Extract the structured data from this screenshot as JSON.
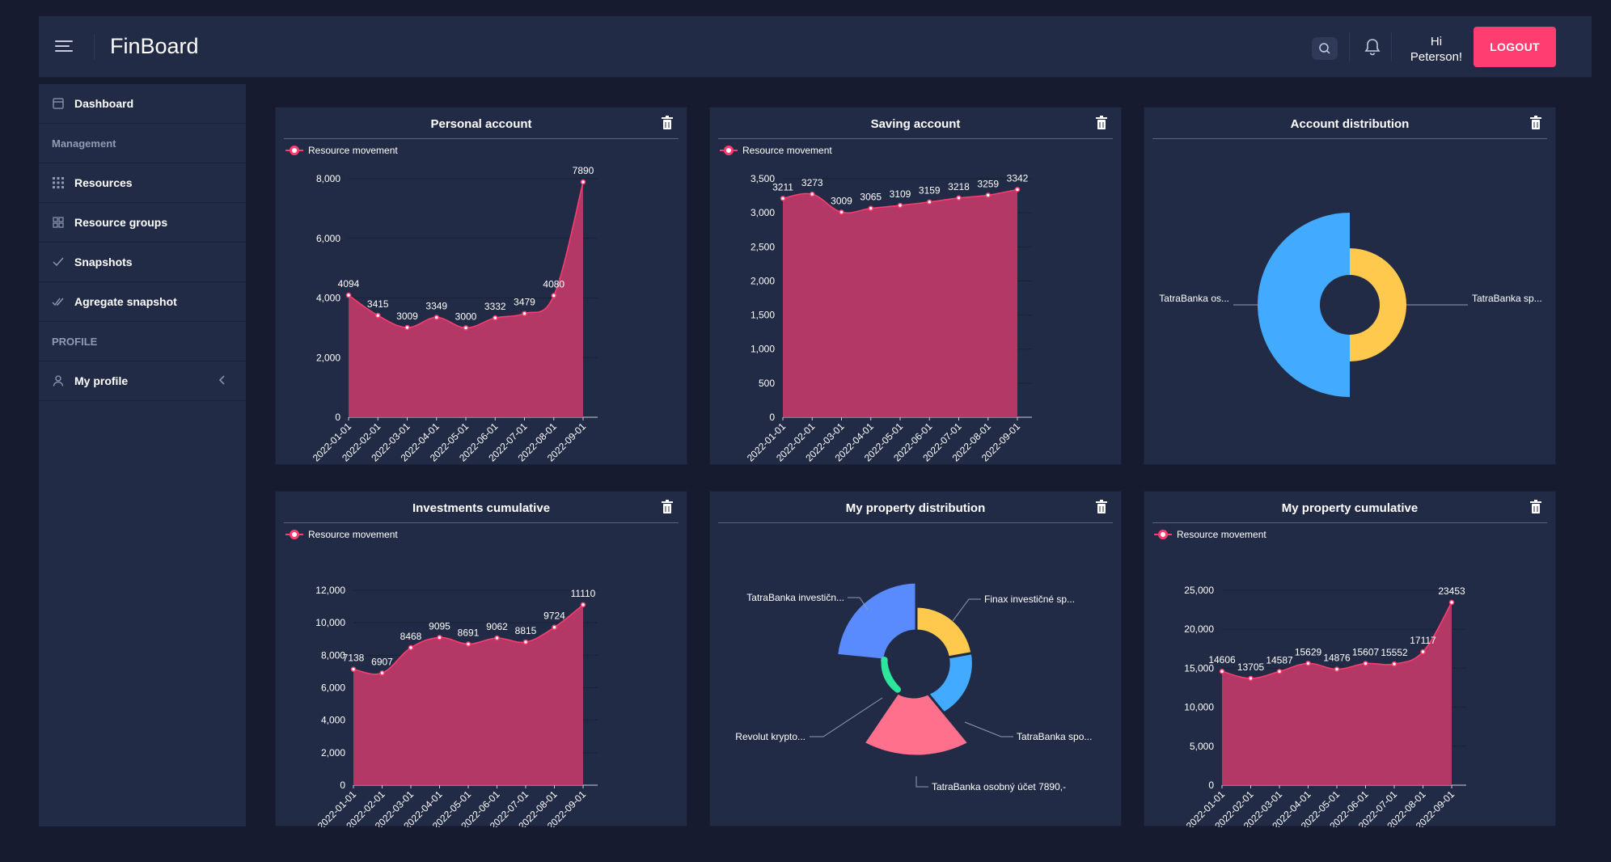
{
  "header": {
    "brand": "FinBoard",
    "greeting": "Hi Peterson!",
    "logout": "LOGOUT"
  },
  "sidebar": {
    "items": [
      {
        "label": "Dashboard"
      },
      {
        "label": "Management"
      },
      {
        "label": "Resources"
      },
      {
        "label": "Resource groups"
      },
      {
        "label": "Snapshots"
      },
      {
        "label": "Agregate snapshot"
      },
      {
        "label": "PROFILE"
      },
      {
        "label": "My profile"
      }
    ]
  },
  "colors": {
    "accent": "#ff3d71",
    "area": "#c13a68",
    "blue": "#42aaff",
    "yellow": "#ffc94d",
    "green": "#2ce69b",
    "indigo": "#598bff",
    "pink": "#ff708d"
  },
  "cards": {
    "personal": {
      "title": "Personal account",
      "legend": "Resource movement"
    },
    "saving": {
      "title": "Saving account",
      "legend": "Resource movement"
    },
    "distribution": {
      "title": "Account distribution"
    },
    "investments": {
      "title": "Investments cumulative",
      "legend": "Resource movement"
    },
    "property_dist": {
      "title": "My property distribution"
    },
    "property_cum": {
      "title": "My property cumulative",
      "legend": "Resource movement"
    }
  },
  "chart_data": [
    {
      "type": "area",
      "title": "Personal account",
      "series": [
        {
          "name": "Resource movement",
          "values": [
            4094,
            3415,
            3009,
            3349,
            3000,
            3332,
            3479,
            4080,
            7890
          ]
        }
      ],
      "x": [
        "2022-01-01",
        "2022-02-01",
        "2022-03-01",
        "2022-04-01",
        "2022-05-01",
        "2022-06-01",
        "2022-07-01",
        "2022-08-01",
        "2022-09-01"
      ],
      "ylim": [
        0,
        8000
      ],
      "yticks": [
        0,
        2000,
        4000,
        6000,
        8000
      ],
      "ytick_labels": [
        "0",
        "2,000",
        "4,000",
        "6,000",
        "8,000"
      ],
      "labels": [
        "4094",
        "3415",
        "3009",
        "3349",
        "3000",
        "3332",
        "3479",
        "4080",
        "7890"
      ]
    },
    {
      "type": "area",
      "title": "Saving account",
      "series": [
        {
          "name": "Resource movement",
          "values": [
            3211,
            3273,
            3009,
            3065,
            3109,
            3159,
            3218,
            3259,
            3342
          ]
        }
      ],
      "x": [
        "2022-01-01",
        "2022-02-01",
        "2022-03-01",
        "2022-04-01",
        "2022-05-01",
        "2022-06-01",
        "2022-07-01",
        "2022-08-01",
        "2022-09-01"
      ],
      "ylim": [
        0,
        3500
      ],
      "yticks": [
        0,
        500,
        1000,
        1500,
        2000,
        2500,
        3000,
        3500
      ],
      "ytick_labels": [
        "0",
        "500",
        "1,000",
        "1,500",
        "2,000",
        "2,500",
        "3,000",
        "3,500"
      ],
      "labels": [
        "3211",
        "3273",
        "3009",
        "3065",
        "3109",
        "3159",
        "3218",
        "3259",
        "3342"
      ]
    },
    {
      "type": "pie",
      "title": "Account distribution",
      "categories": [
        "TatraBanka os...",
        "TatraBanka sp..."
      ],
      "values": [
        7890,
        3342
      ]
    },
    {
      "type": "area",
      "title": "Investments cumulative",
      "series": [
        {
          "name": "Resource movement",
          "values": [
            7138,
            6907,
            8468,
            9095,
            8691,
            9062,
            8815,
            9724,
            11110
          ]
        }
      ],
      "x": [
        "2022-01-01",
        "2022-02-01",
        "2022-03-01",
        "2022-04-01",
        "2022-05-01",
        "2022-06-01",
        "2022-07-01",
        "2022-08-01",
        "2022-09-01"
      ],
      "ylim": [
        0,
        12000
      ],
      "yticks": [
        0,
        2000,
        4000,
        6000,
        8000,
        10000,
        12000
      ],
      "ytick_labels": [
        "0",
        "2,000",
        "4,000",
        "6,000",
        "8,000",
        "10,000",
        "12,000"
      ],
      "labels": [
        "7138",
        "6907",
        "8468",
        "9095",
        "8691",
        "9062",
        "8815",
        "9724",
        "11110"
      ]
    },
    {
      "type": "pie",
      "title": "My property distribution",
      "categories": [
        "TatraBanka investičn...",
        "Finax investičné sp...",
        "TatraBanka spo...",
        "TatraBanka osobný účet 7890,-",
        "Revolut krypto..."
      ]
    },
    {
      "type": "area",
      "title": "My property cumulative",
      "series": [
        {
          "name": "Resource movement",
          "values": [
            14606,
            13705,
            14587,
            15629,
            14876,
            15607,
            15552,
            17117,
            23453
          ]
        }
      ],
      "x": [
        "2022-01-01",
        "2022-02-01",
        "2022-03-01",
        "2022-04-01",
        "2022-05-01",
        "2022-06-01",
        "2022-07-01",
        "2022-08-01",
        "2022-09-01"
      ],
      "ylim": [
        0,
        25000
      ],
      "yticks": [
        0,
        5000,
        10000,
        15000,
        20000,
        25000
      ],
      "ytick_labels": [
        "0",
        "5,000",
        "10,000",
        "15,000",
        "20,000",
        "25,000"
      ],
      "labels": [
        "14606",
        "13705",
        "14587",
        "15629",
        "14876",
        "15607",
        "15552",
        "17117",
        "23453"
      ]
    }
  ]
}
